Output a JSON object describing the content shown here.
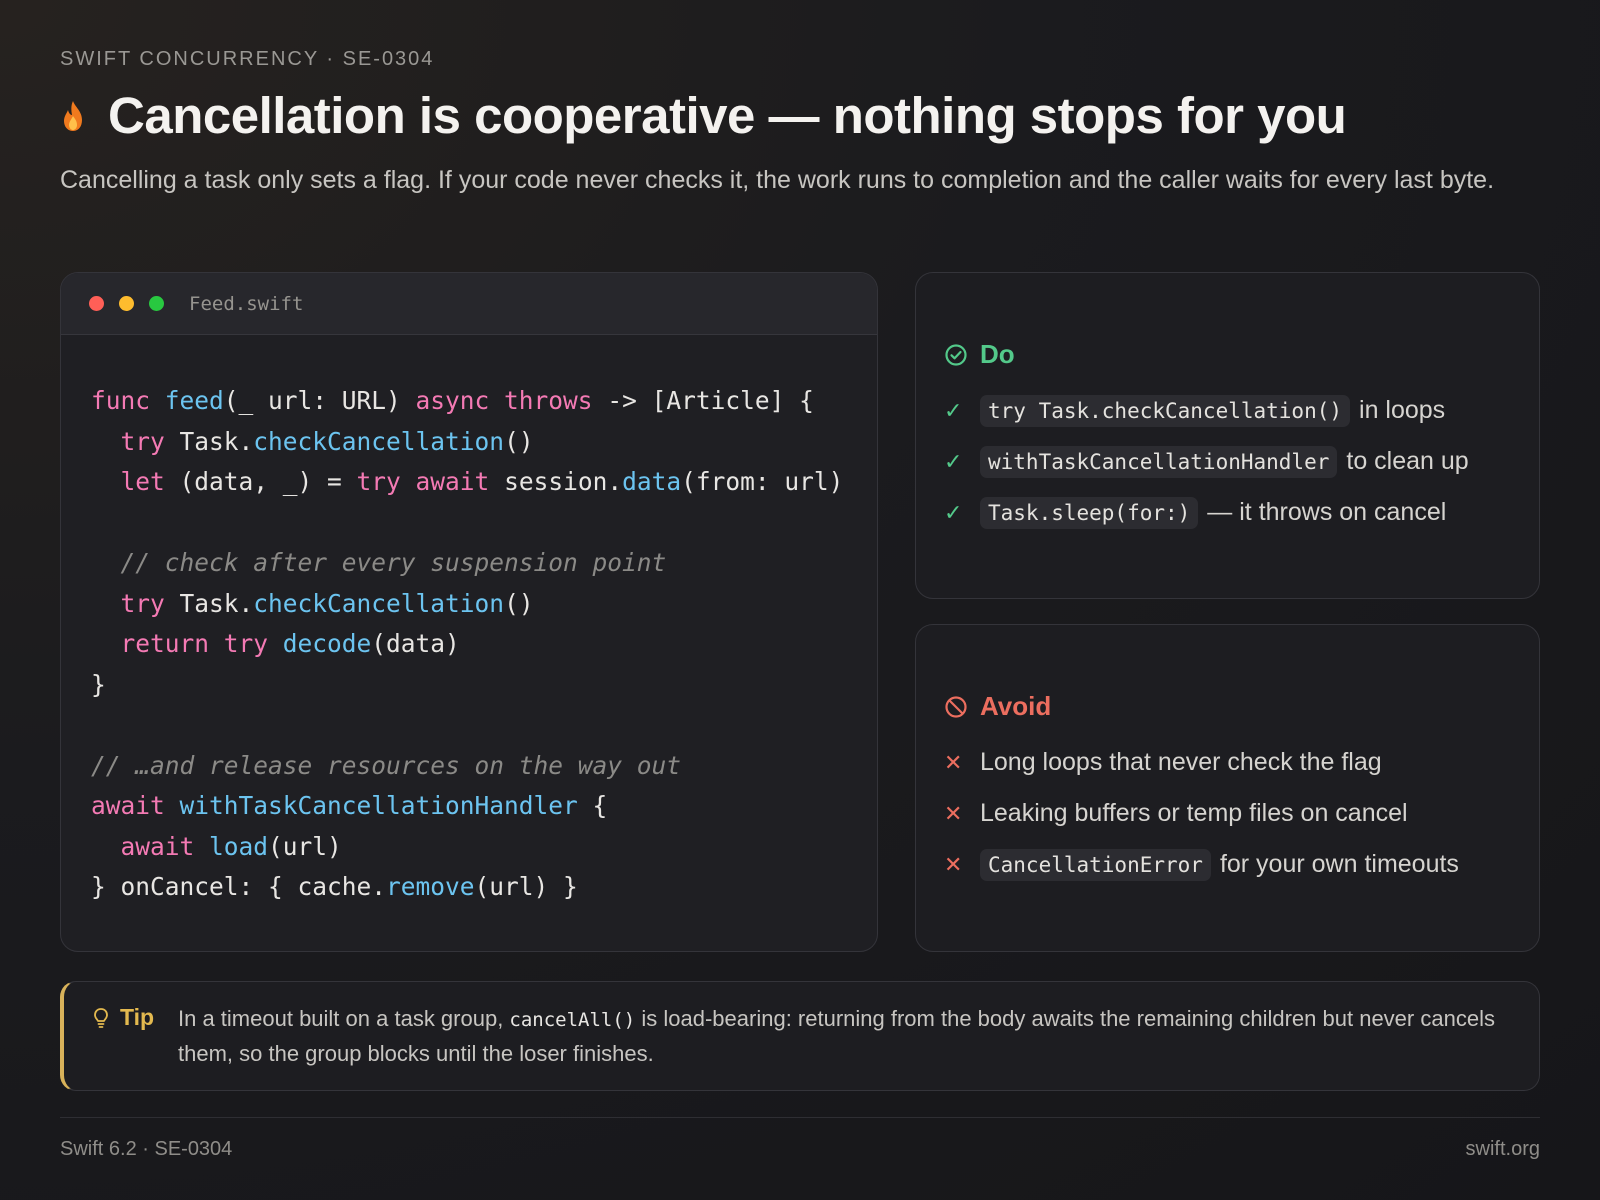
{
  "header": {
    "eyebrow": "SWIFT CONCURRENCY · SE-0304",
    "title": "Cancellation is cooperative — nothing stops for you",
    "lede": "Cancelling a task only sets a flag. If your code never checks it, the work runs to completion and the caller waits for every last byte.",
    "icon": "flame-icon"
  },
  "code_card": {
    "filename": "Feed.swift",
    "lines": [
      [
        [
          "kw",
          "func "
        ],
        [
          "fn",
          "feed"
        ],
        [
          "",
          "(_ url: URL) "
        ],
        [
          "kw",
          "async throws "
        ],
        [
          "",
          "-> [Article] {"
        ]
      ],
      [
        [
          "",
          "  "
        ],
        [
          "kw",
          "try "
        ],
        [
          "",
          "Task."
        ],
        [
          "fn",
          "checkCancellation"
        ],
        [
          "",
          "()"
        ]
      ],
      [
        [
          "",
          "  "
        ],
        [
          "kw",
          "let "
        ],
        [
          "",
          "(data, _) = "
        ],
        [
          "kw",
          "try await "
        ],
        [
          "",
          "session."
        ],
        [
          "fn",
          "data"
        ],
        [
          "",
          "(from: url)"
        ]
      ],
      [],
      [
        [
          "cm",
          "  // check after every suspension point"
        ]
      ],
      [
        [
          "",
          "  "
        ],
        [
          "kw",
          "try "
        ],
        [
          "",
          "Task."
        ],
        [
          "fn",
          "checkCancellation"
        ],
        [
          "",
          "()"
        ]
      ],
      [
        [
          "",
          "  "
        ],
        [
          "kw",
          "return try "
        ],
        [
          "fn",
          "decode"
        ],
        [
          "",
          "(data)"
        ]
      ],
      [
        [
          "",
          "}"
        ]
      ],
      [],
      [
        [
          "cm",
          "// …and release resources on the way out"
        ]
      ],
      [
        [
          "kw",
          "await "
        ],
        [
          "fn",
          "withTaskCancellationHandler"
        ],
        [
          "",
          " {"
        ]
      ],
      [
        [
          "",
          "  "
        ],
        [
          "kw",
          "await "
        ],
        [
          "fn",
          "load"
        ],
        [
          "",
          "(url)"
        ]
      ],
      [
        [
          "",
          "} onCancel: { cache."
        ],
        [
          "fn",
          "remove"
        ],
        [
          "",
          "(url) }"
        ]
      ]
    ]
  },
  "do_card": {
    "title": "Do",
    "items": [
      {
        "code": "try Task.checkCancellation()",
        "text": "in loops"
      },
      {
        "code": "withTaskCancellationHandler",
        "text": "to clean up"
      },
      {
        "code": "Task.sleep(for:)",
        "text": "— it throws on cancel"
      }
    ]
  },
  "avoid_card": {
    "title": "Avoid",
    "items": [
      {
        "code": "",
        "text": "Long loops that never check the flag"
      },
      {
        "code": "",
        "text": "Leaking buffers or temp files on cancel"
      },
      {
        "code": "CancellationError",
        "text": "for your own timeouts"
      }
    ]
  },
  "tip": {
    "label": "Tip",
    "text_before": "In a timeout built on a task group, ",
    "code": "cancelAll()",
    "text_after": " is load-bearing: returning from the body awaits the remaining children but never cancels them, so the group blocks until the loser finishes."
  },
  "footer": {
    "left": "Swift 6.2 · SE-0304",
    "right": "swift.org"
  },
  "colors": {
    "keyword": "#f47ab4",
    "function": "#6cc4f0",
    "comment": "#8b8a87",
    "do_accent": "#53c98a",
    "avoid_accent": "#ec6e5f",
    "tip_accent": "#e3b94f"
  }
}
